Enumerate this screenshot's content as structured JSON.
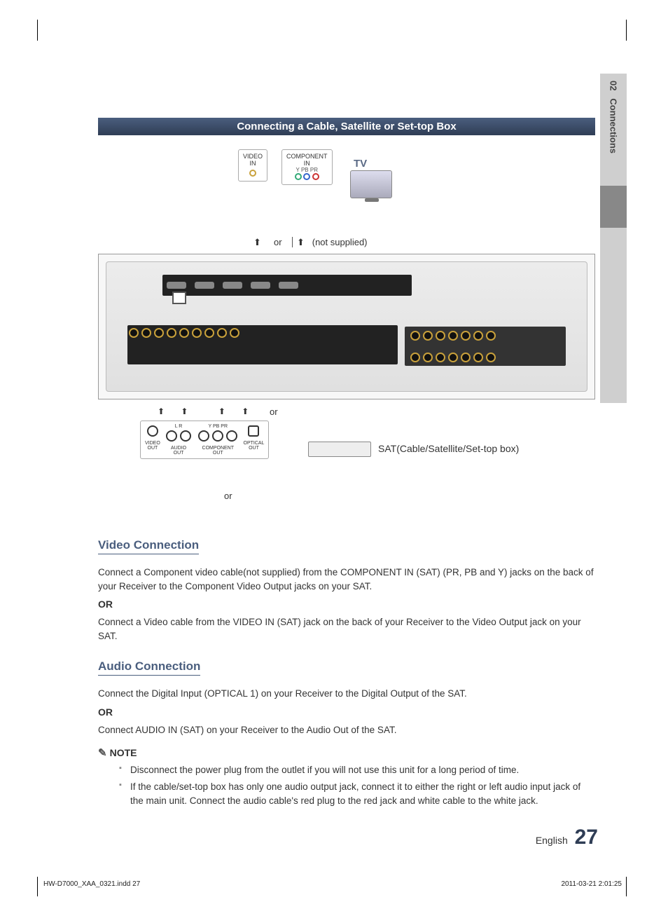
{
  "side_tab": {
    "chapter_num": "02",
    "chapter_title": "Connections"
  },
  "section_title": "Connecting a Cable, Satellite or Set-top Box",
  "diagram": {
    "tv_label": "TV",
    "video_in": "VIDEO\nIN",
    "component_in": "COMPONENT\nIN",
    "ypbpr": "Y   PB  PR",
    "or1": "or",
    "not_supplied": "(not supplied)",
    "or2": "or",
    "or3": "or",
    "sat_label": "SAT(Cable/Satellite/Set-top box)",
    "out_labels": {
      "video": "VIDEO\nOUT",
      "audio": "AUDIO\nOUT",
      "audio_lr": "L      R",
      "component": "COMPONENT\nOUT",
      "component_ypbpr": "Y   PB  PR",
      "optical": "OPTICAL\nOUT"
    }
  },
  "video_heading": "Video Connection",
  "video_p1": "Connect a Component video cable(not supplied) from the COMPONENT IN (SAT) (PR, PB and Y) jacks on the back of your Receiver to the Component Video Output jacks on your SAT.",
  "or": "OR",
  "video_p2": "Connect a Video cable from the VIDEO IN (SAT) jack on the back of your Receiver to the Video Output jack on your SAT.",
  "audio_heading": "Audio Connection",
  "audio_p1": "Connect the Digital Input (OPTICAL 1) on your Receiver to the Digital Output of the SAT.",
  "audio_p2": "Connect AUDIO IN (SAT) on your Receiver to the Audio Out of the SAT.",
  "note_label": "NOTE",
  "notes": [
    "Disconnect the power plug from the outlet if you will not use this unit for a long period of time.",
    "If the cable/set-top box has only one audio output jack, connect it to either the right or left audio input jack of the main unit. Connect the audio cable's red plug to the red jack and white cable to the white jack."
  ],
  "footer": {
    "lang": "English",
    "page": "27",
    "file": "HW-D7000_XAA_0321.indd   27",
    "date": "2011-03-21   2:01:25"
  }
}
